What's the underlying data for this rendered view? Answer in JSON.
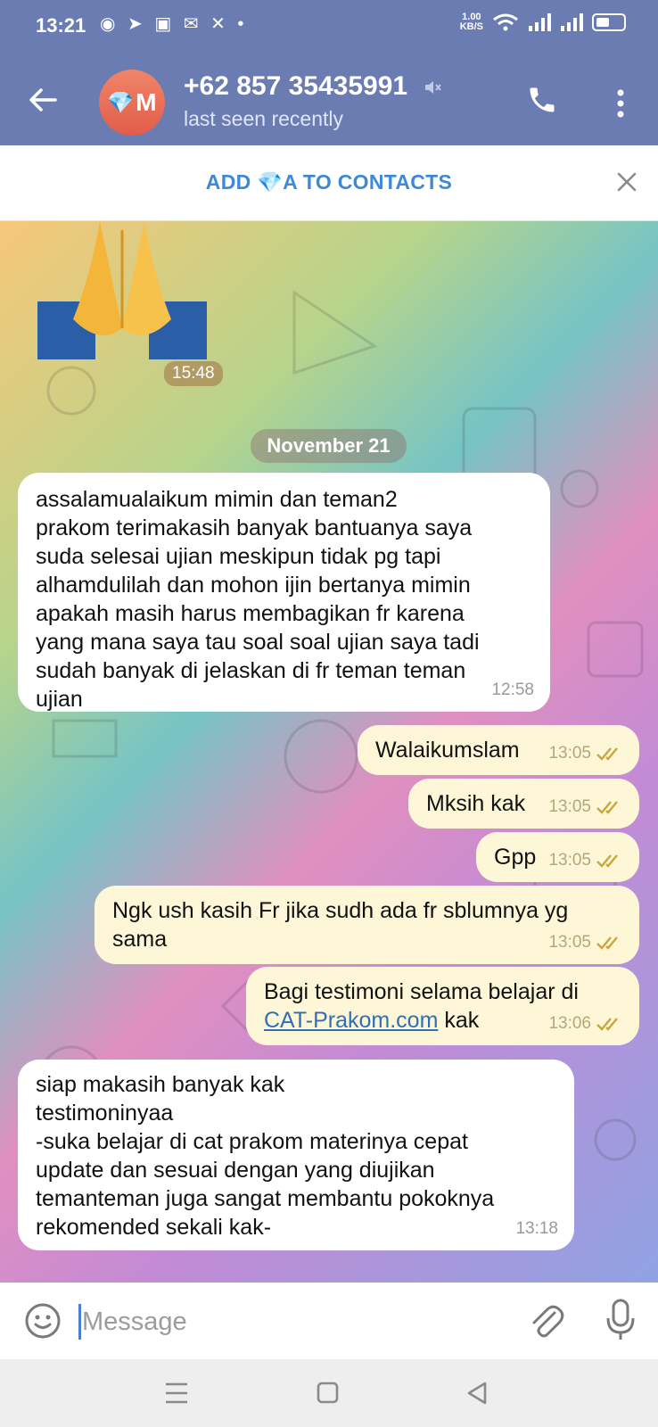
{
  "status_bar": {
    "time": "13:21",
    "net_speed": "1.00",
    "net_unit": "KB/S"
  },
  "header": {
    "avatar_initial": "M",
    "contact_name": "+62 857 35435991",
    "contact_status": "last seen recently"
  },
  "add_contact_bar": {
    "label": "ADD 💎A TO CONTACTS"
  },
  "chat": {
    "sticker_time": "15:48",
    "date_separator": "November 21",
    "messages": [
      {
        "direction": "in",
        "text": "assalamualaikum mimin dan teman2\nprakom terimakasih banyak bantuanya saya\nsuda selesai ujian meskipun tidak pg tapi\nalhamdulilah dan mohon ijin bertanya mimin\napakah masih harus membagikan fr karena\nyang mana saya tau soal soal ujian saya tadi\nsudah banyak di jelaskan di fr teman teman\nujian",
        "time": "12:58"
      },
      {
        "direction": "out",
        "text": "Walaikumslam",
        "time": "13:05",
        "read": true
      },
      {
        "direction": "out",
        "text": "Mksih kak",
        "time": "13:05",
        "read": true
      },
      {
        "direction": "out",
        "text": "Gpp",
        "time": "13:05",
        "read": true
      },
      {
        "direction": "out",
        "text": "Ngk ush kasih Fr jika sudh ada fr sblumnya yg\nsama",
        "time": "13:05",
        "read": true
      },
      {
        "direction": "out",
        "text_before": "Bagi testimoni selama belajar di\n",
        "link": "CAT-Prakom.com",
        "text_after": " kak",
        "time": "13:06",
        "read": true
      },
      {
        "direction": "in",
        "text": "siap makasih banyak kak\ntestimoninyaa\n-suka belajar di cat prakom materinya cepat\nupdate dan sesuai dengan yang diujikan\ntemanteman juga sangat membantu pokoknya\nrekomended sekali kak-",
        "time": "13:18"
      }
    ]
  },
  "composer": {
    "placeholder": "Message"
  },
  "colors": {
    "header_bg": "#6a7cb2",
    "accent": "#3e88d8",
    "outgoing_bubble": "#fdf7d8",
    "incoming_bubble": "#ffffff",
    "read_tick": "#c9a63c"
  },
  "icons": [
    "back-arrow-icon",
    "mute-icon",
    "phone-icon",
    "more-vertical-icon",
    "close-icon",
    "emoji-icon",
    "attach-icon",
    "mic-icon",
    "menu-icon",
    "home-icon",
    "back-triangle-icon"
  ]
}
